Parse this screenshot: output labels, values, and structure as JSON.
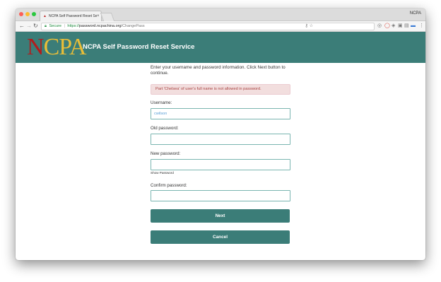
{
  "browser": {
    "tab_title": "NCPA Self Password Reset Se",
    "tab_close": "×",
    "profile_name": "NCPA",
    "secure_label": "Secure",
    "url_scheme": "https://",
    "url_host": "password.ncpachina.org",
    "url_path": "/ChangePass",
    "back_glyph": "←",
    "forward_glyph": "→",
    "reload_glyph": "↻",
    "menu_glyph": "⋮"
  },
  "header": {
    "logo_n": "N",
    "logo_cpa": "CPA",
    "title": "NCPA Self Password Reset Service",
    "colors": {
      "bar": "#3b7d78",
      "logo_red": "#b11d1d",
      "logo_gold": "#e8bd38"
    }
  },
  "form": {
    "instructions": "Enter your username and password information. Click Next button to continue.",
    "error_message": "Part 'Chelsea' of user's full name is not allowed in password.",
    "username_label": "Username:",
    "username_value": "cwilson",
    "old_password_label": "Old password:",
    "new_password_label": "New password:",
    "show_password_label": "Show Password",
    "confirm_password_label": "Confirm password:",
    "next_label": "Next",
    "cancel_label": "Cancel"
  },
  "icons": [
    "favicon-icon",
    "lock-icon",
    "key-icon",
    "star-icon",
    "extension-icon",
    "opera-icon",
    "menu-icon"
  ]
}
